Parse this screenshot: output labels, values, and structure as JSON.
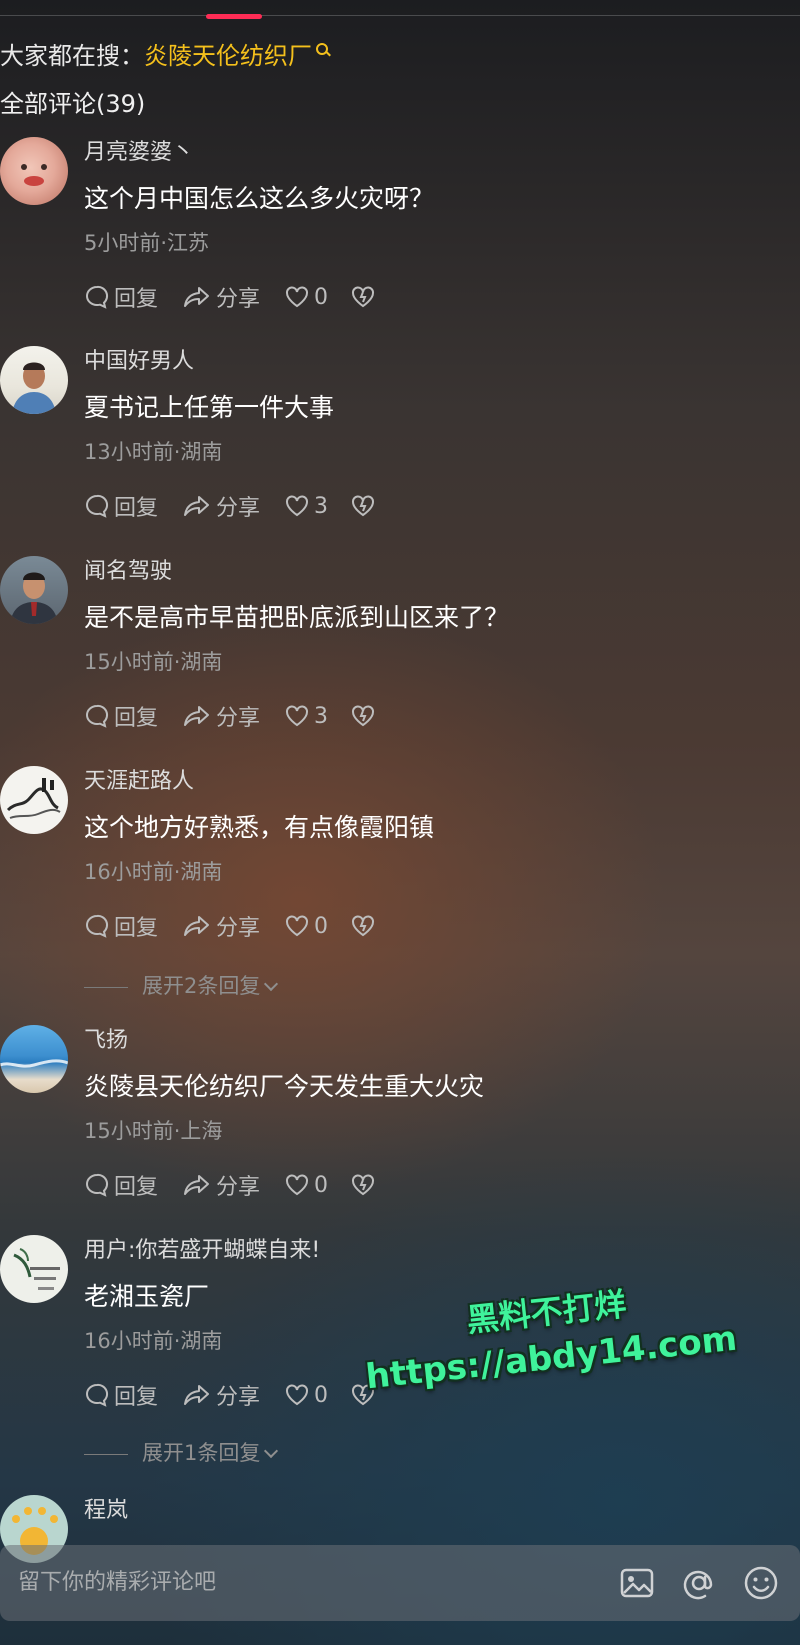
{
  "search": {
    "prefix": "大家都在搜：",
    "keyword": "炎陵天伦纺织厂"
  },
  "comments_title": "全部评论(39)",
  "labels": {
    "reply": "回复",
    "share": "分享"
  },
  "comments": [
    {
      "user": "月亮婆婆丶",
      "text": "这个月中国怎么这么多火灾呀？",
      "meta": "5小时前·江苏",
      "likes": "0"
    },
    {
      "user": "中国好男人",
      "text": "夏书记上任第一件大事",
      "meta": "13小时前·湖南",
      "likes": "3"
    },
    {
      "user": "闻名驾驶",
      "text": "是不是高市早苗把卧底派到山区来了？",
      "meta": "15小时前·湖南",
      "likes": "3"
    },
    {
      "user": "天涯赶路人",
      "text": "这个地方好熟悉，有点像霞阳镇",
      "meta": "16小时前·湖南",
      "likes": "0",
      "expand": "展开2条回复"
    },
    {
      "user": "飞扬",
      "text": "炎陵县天伦纺织厂今天发生重大火灾",
      "meta": "15小时前·上海",
      "likes": "0"
    },
    {
      "user": "用户:你若盛开蝴蝶自来!",
      "text": "老湘玉瓷厂",
      "meta": "16小时前·湖南",
      "likes": "0",
      "expand": "展开1条回复"
    },
    {
      "user": "程岚"
    }
  ],
  "watermark": {
    "line1": "黑料不打烊",
    "line2": "https://abdy14.com"
  },
  "input": {
    "placeholder": "留下你的精彩评论吧"
  },
  "colors": {
    "accent": "#fe2c55",
    "search_keyword": "#f4c01c",
    "watermark": "#3ff39b"
  },
  "icons": [
    "magnifier-icon",
    "comment-bubble-icon",
    "share-arrow-icon",
    "heart-icon",
    "broken-heart-icon",
    "image-icon",
    "at-icon",
    "emoji-icon"
  ]
}
